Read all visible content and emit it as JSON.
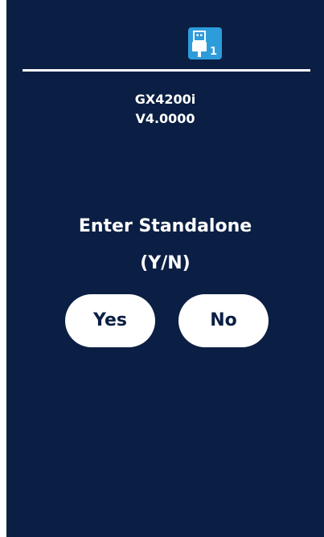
{
  "status_bar": {
    "usb_icon": "usb-plug-icon",
    "usb_port_number": "1",
    "accent_color": "#2d9cdb"
  },
  "device": {
    "name": "GX4200i",
    "firmware": "V4.0000"
  },
  "prompt": {
    "title": "Enter Standalone",
    "subtitle": "(Y/N)"
  },
  "buttons": {
    "yes_label": "Yes",
    "no_label": "No"
  },
  "colors": {
    "background": "#0b1f44",
    "text": "#ffffff"
  }
}
